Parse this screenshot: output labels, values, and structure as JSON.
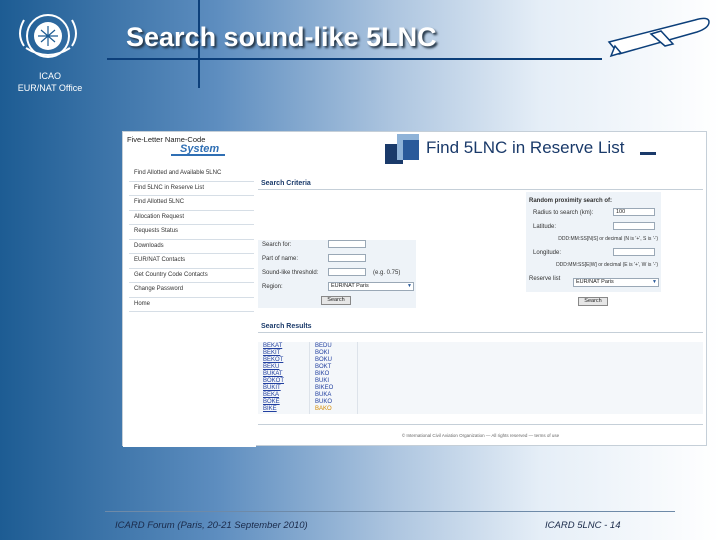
{
  "slide": {
    "title": "Search sound-like 5LNC",
    "org_line1": "ICAO",
    "org_line2": "EUR/NAT Office",
    "footer_left": "ICARD Forum (Paris, 20-21 September 2010)",
    "footer_right": "ICARD 5LNC - 14"
  },
  "app": {
    "sidebar": {
      "header": "Five-Letter Name-Code",
      "system": "System",
      "items": [
        "Find Allotted and Available 5LNC",
        "Find 5LNC in Reserve List",
        "Find Allotted 5LNC",
        "Allocation Request",
        "Requests Status",
        "Downloads",
        "EUR/NAT Contacts",
        "Get Country Code Contacts",
        "Change Password",
        "Home"
      ]
    },
    "reserve_title": "Find 5LNC in Reserve List",
    "search_criteria": "Search Criteria",
    "left_form": {
      "sound_label": "Search for:",
      "sound_value": "",
      "name_label": "Part of name:",
      "name_value": "",
      "similar_label": "Sound-like threshold:",
      "similar_value": "",
      "similar_hint": "(e.g. 0.75)",
      "region_label": "Region:",
      "region_value": "EUR/NAT Paris",
      "search_btn": "Search"
    },
    "right_form": {
      "title": "Random proximity search of:",
      "radius_label": "Radius to search (km):",
      "radius_value": "100",
      "lat_label": "Latitude:",
      "lat_value": "",
      "lat_hint": "DDD:MM:SS[N|S] or decimal (N is '+', S is '-')",
      "lon_label": "Longitude:",
      "lon_value": "",
      "lon_hint": "DDD:MM:SS[E|W] or decimal (E is '+', W is '-')",
      "reserve_label": "Reserve list",
      "reserve_value": "EUR/NAT Paris",
      "search_btn": "Search"
    },
    "results": {
      "title": "Search Results",
      "col1": [
        "BEKAT",
        "BEKIT",
        "BEKOT",
        "BEKU",
        "BUKAT",
        "BOKOT",
        "BUKIT",
        "BEKA",
        "BOKE",
        "BIKE"
      ],
      "col2": [
        "BEDU",
        "BOKI",
        "BOKU",
        "BOKT",
        "BIKO",
        "BUKI",
        "BIKEO",
        "BUKA",
        "BUKO",
        "BAKO"
      ],
      "col2_orange_index": 9
    },
    "footer": "© International Civil Aviation Organization — All rights reserved — terms of use"
  }
}
